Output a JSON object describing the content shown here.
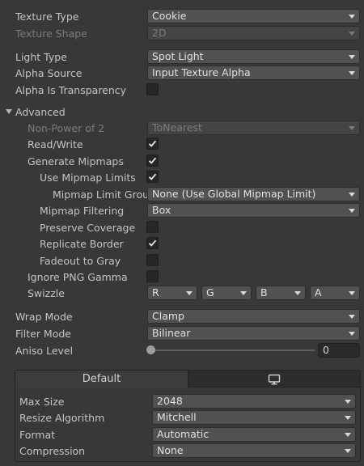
{
  "fields": {
    "texture_type": {
      "label": "Texture Type",
      "value": "Cookie"
    },
    "texture_shape": {
      "label": "Texture Shape",
      "value": "2D"
    },
    "light_type": {
      "label": "Light Type",
      "value": "Spot Light"
    },
    "alpha_source": {
      "label": "Alpha Source",
      "value": "Input Texture Alpha"
    },
    "alpha_is_transparency": {
      "label": "Alpha Is Transparency",
      "checked": false
    }
  },
  "advanced": {
    "label": "Advanced",
    "non_power_of_2": {
      "label": "Non-Power of 2",
      "value": "ToNearest"
    },
    "read_write": {
      "label": "Read/Write",
      "checked": true
    },
    "generate_mipmaps": {
      "label": "Generate Mipmaps",
      "checked": true
    },
    "use_mipmap_limits": {
      "label": "Use Mipmap Limits",
      "checked": true
    },
    "mipmap_limit_group": {
      "label": "Mipmap Limit Group",
      "value": "None (Use Global Mipmap Limit)"
    },
    "mipmap_filtering": {
      "label": "Mipmap Filtering",
      "value": "Box"
    },
    "preserve_coverage": {
      "label": "Preserve Coverage",
      "checked": false
    },
    "replicate_border": {
      "label": "Replicate Border",
      "checked": true
    },
    "fadeout_to_gray": {
      "label": "Fadeout to Gray",
      "checked": false
    },
    "ignore_png_gamma": {
      "label": "Ignore PNG Gamma",
      "checked": false
    },
    "swizzle": {
      "label": "Swizzle",
      "r": "R",
      "g": "G",
      "b": "B",
      "a": "A"
    }
  },
  "wrap_mode": {
    "label": "Wrap Mode",
    "value": "Clamp"
  },
  "filter_mode": {
    "label": "Filter Mode",
    "value": "Bilinear"
  },
  "aniso_level": {
    "label": "Aniso Level",
    "value": "0",
    "fraction": 0.0
  },
  "platform": {
    "tabs": [
      {
        "label": "Default",
        "selected": true
      },
      {
        "icon": "monitor-icon",
        "selected": false
      }
    ],
    "max_size": {
      "label": "Max Size",
      "value": "2048"
    },
    "resize_algorithm": {
      "label": "Resize Algorithm",
      "value": "Mitchell"
    },
    "format": {
      "label": "Format",
      "value": "Automatic"
    },
    "compression": {
      "label": "Compression",
      "value": "None"
    }
  }
}
